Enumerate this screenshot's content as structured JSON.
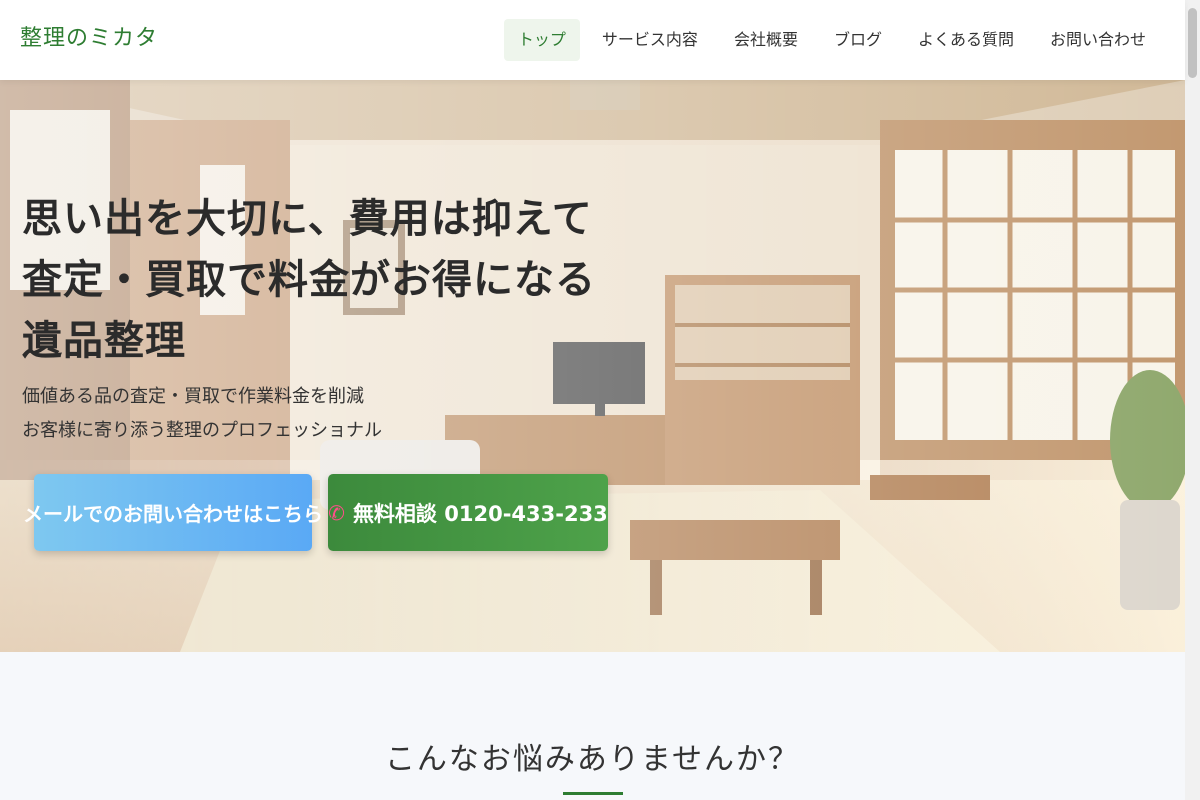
{
  "header": {
    "logo": "整理のミカタ",
    "nav": [
      {
        "label": "トップ",
        "active": true
      },
      {
        "label": "サービス内容",
        "active": false
      },
      {
        "label": "会社概要",
        "active": false
      },
      {
        "label": "ブログ",
        "active": false
      },
      {
        "label": "よくある質問",
        "active": false
      },
      {
        "label": "お問い合わせ",
        "active": false
      }
    ]
  },
  "hero": {
    "headline": [
      "思い出を大切に、費用は抑えて",
      "査定・買取で料金がお得になる",
      "遺品整理"
    ],
    "subtext": [
      "価値ある品の査定・買取で作業料金を削減",
      "お客様に寄り添う整理のプロフェッショナル"
    ],
    "mail_button": "メールでのお問い合わせはこちら",
    "phone_button": "無料相談 0120-433-233",
    "phone_icon": "phone-icon"
  },
  "section": {
    "title": "こんなお悩みありませんか？"
  },
  "colors": {
    "brand": "#2e7d32",
    "mail_button": "#5aa9f5",
    "phone_button": "#3c8a3c",
    "phone_icon": "#ff4e8a"
  }
}
